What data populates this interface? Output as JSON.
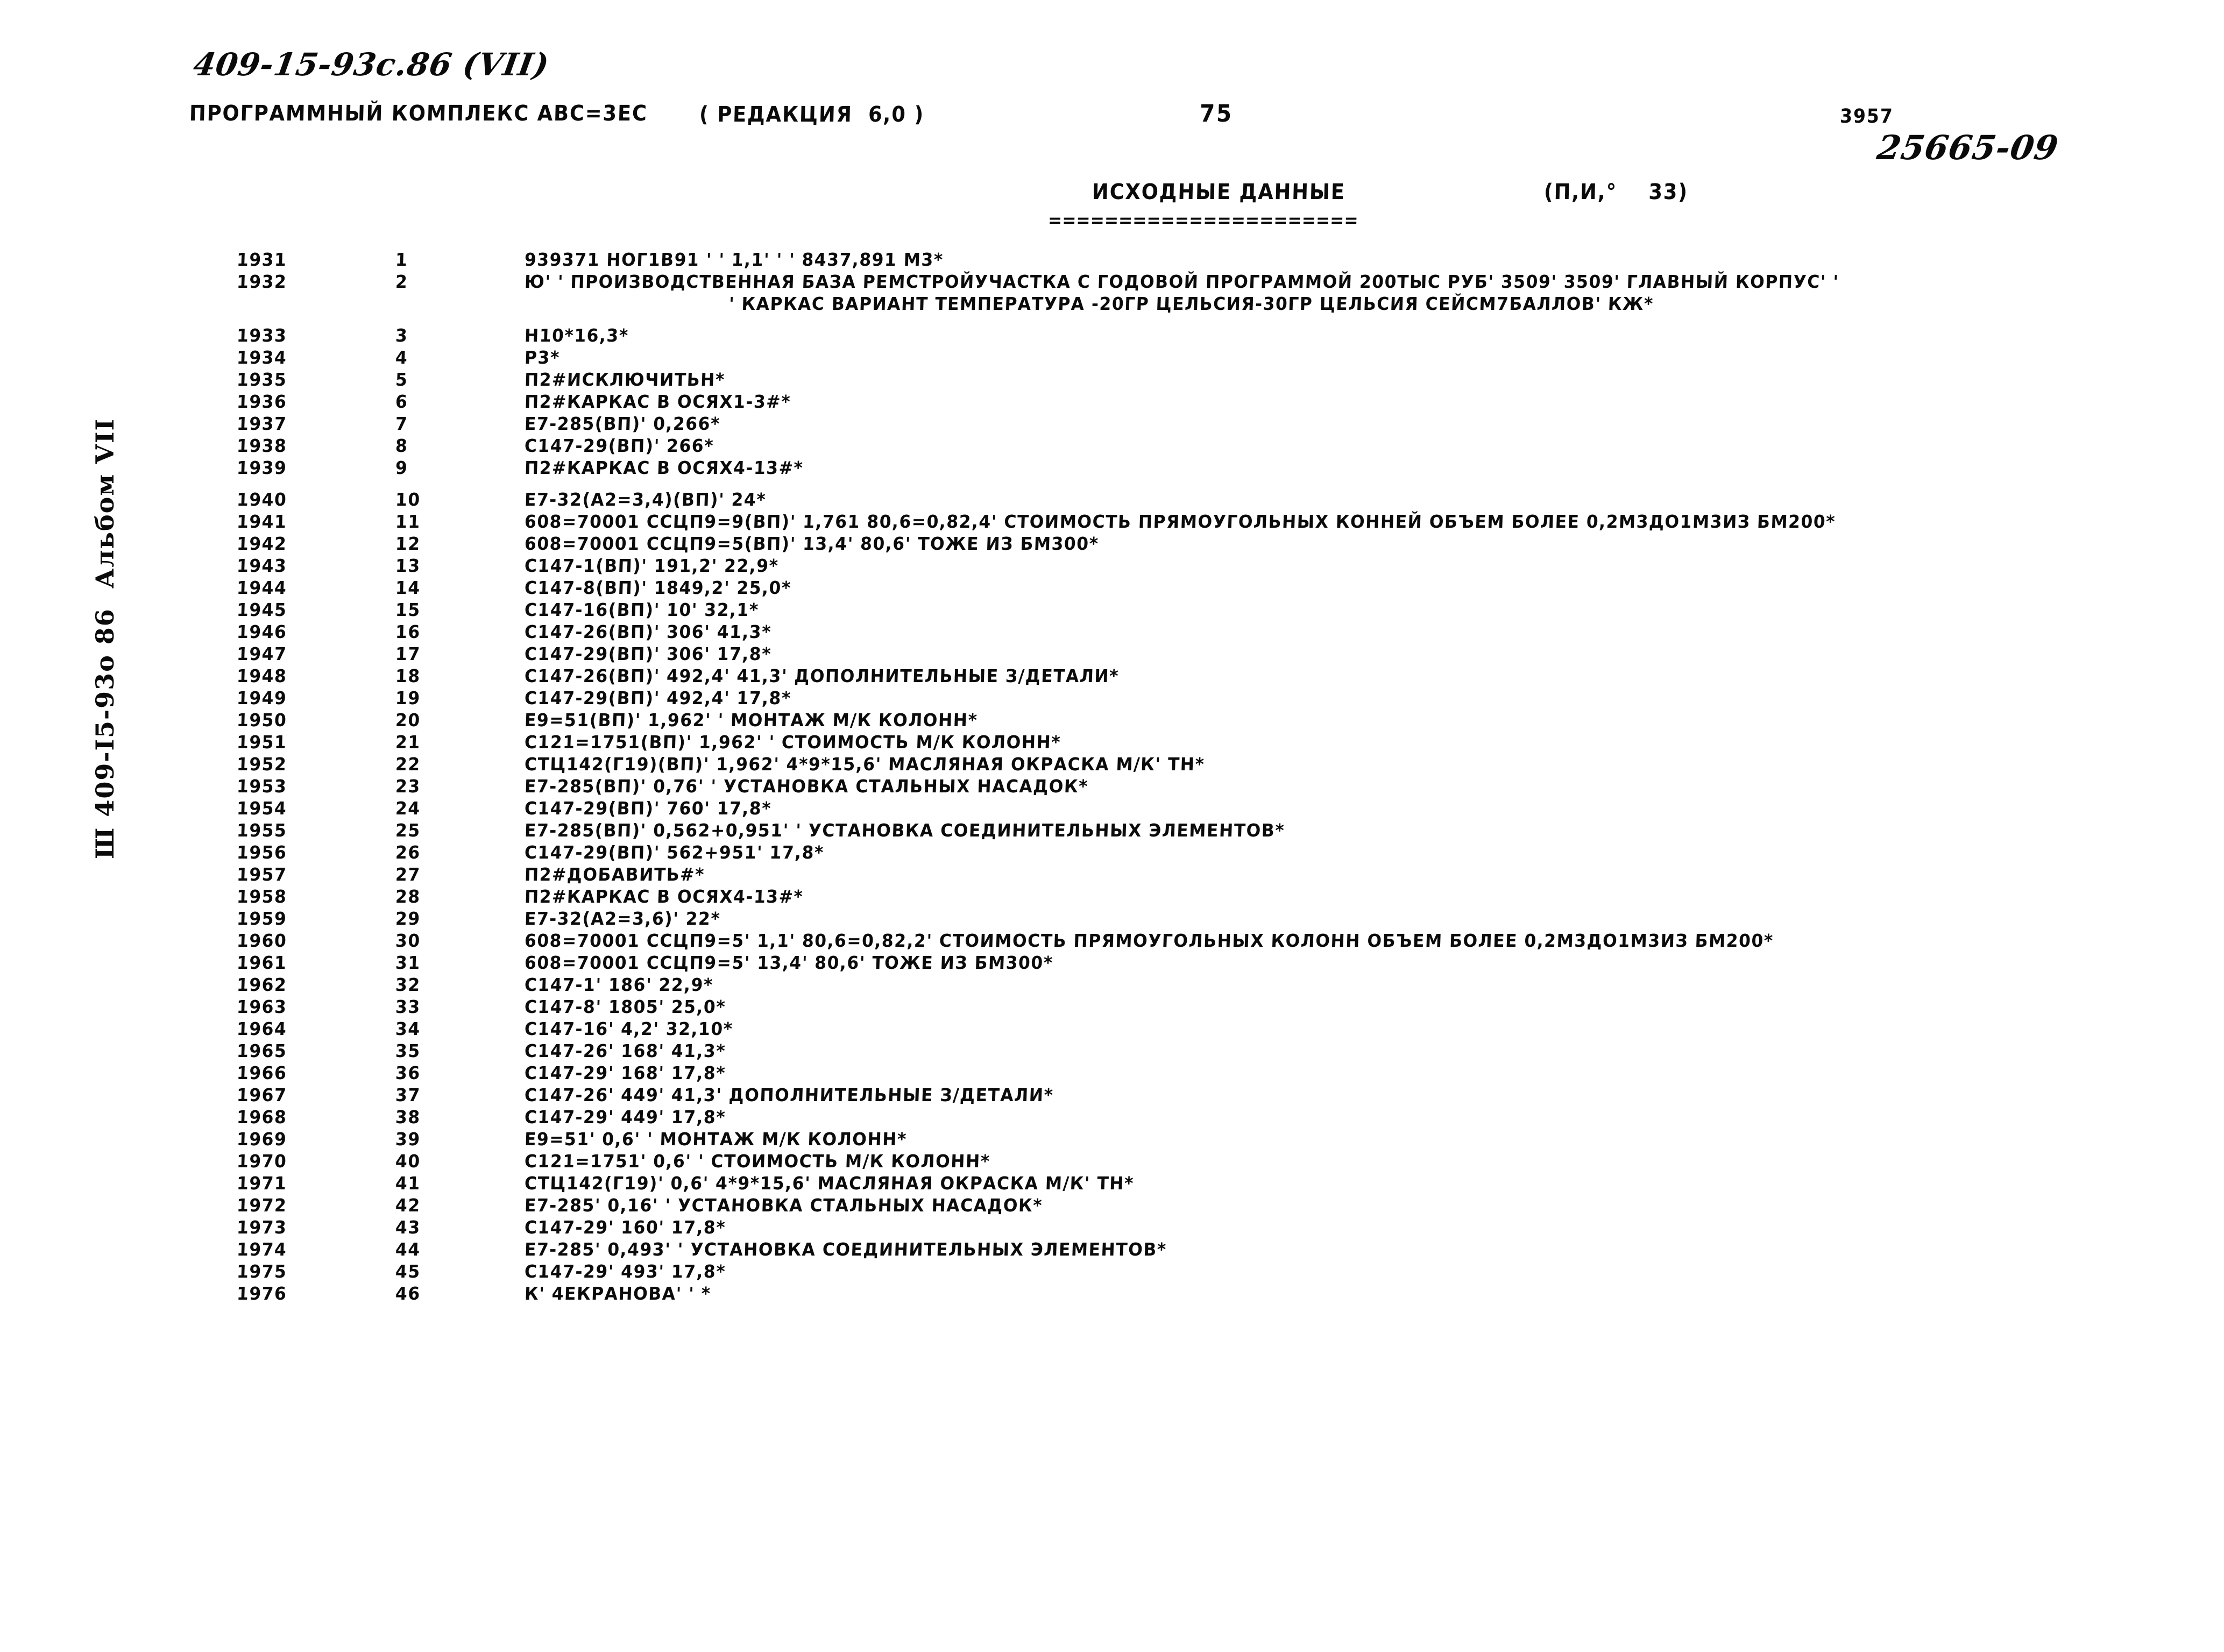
{
  "header": {
    "doc_code_handwritten": "409-15-93с.86 (VII)",
    "complex_line": "ПРОГРАММНЫЙ КОМПЛЕКС АВС=3ЕС",
    "redaction": "( РЕДАКЦИЯ  6,0 )",
    "page_number": "75",
    "small_number": "3957",
    "doc_number_handwritten": "25665-09"
  },
  "section": {
    "title": "ИСХОДНЫЕ ДАННЫЕ",
    "rule": "======================",
    "right_label": "(П,И,°    33)"
  },
  "margin": {
    "vertical_text": "Ш 409-I5-93о 86  Альбом VII"
  },
  "listing": {
    "columns": [
      "id",
      "no",
      "text"
    ],
    "rows": [
      {
        "id": "1931",
        "no": "1",
        "text": "939371 НОГ1В91 ' ' 1,1' ' ' 8437,891 М3*"
      },
      {
        "id": "1932",
        "no": "2",
        "text": "Ю' ' ПРОИЗВОДСТВЕННАЯ БАЗА РЕМСТРОЙУЧАСТКА С ГОДОВОЙ ПРОГРАММОЙ 200ТЫС РУБ' 3509' 3509' ГЛАВНЫЙ КОРПУС' '",
        "cont": "' КАРКАС ВАРИАНТ ТЕМПЕРАТУРА -20ГР ЦЕЛЬСИЯ-30ГР ЦЕЛЬСИЯ СЕЙСМ7БАЛЛОВ' КЖ*"
      },
      {
        "id": "1933",
        "no": "3",
        "text": "Н10*16,3*"
      },
      {
        "id": "1934",
        "no": "4",
        "text": "Р3*"
      },
      {
        "id": "1935",
        "no": "5",
        "text": "П2#ИСКЛЮЧИТЬН*"
      },
      {
        "id": "1936",
        "no": "6",
        "text": "П2#КАРКАС В ОСЯХ1-3#*"
      },
      {
        "id": "1937",
        "no": "7",
        "text": "Е7-285(ВП)' 0,266*"
      },
      {
        "id": "1938",
        "no": "8",
        "text": "С147-29(ВП)' 266*"
      },
      {
        "id": "1939",
        "no": "9",
        "text": "П2#КАРКАС В ОСЯХ4-13#*"
      },
      {
        "id": "1940",
        "no": "10",
        "text": "Е7-32(А2=3,4)(ВП)' 24*"
      },
      {
        "id": "1941",
        "no": "11",
        "text": "608=70001 ССЦП9=9(ВП)' 1,761 80,6=0,82,4' СТОИМОСТЬ ПРЯМОУГОЛЬНЫХ КОННЕЙ ОБЪЕМ БОЛЕЕ 0,2М3ДО1М3ИЗ БМ200*"
      },
      {
        "id": "1942",
        "no": "12",
        "text": "608=70001 ССЦП9=5(ВП)' 13,4' 80,6' ТОЖЕ ИЗ БМ300*"
      },
      {
        "id": "1943",
        "no": "13",
        "text": "С147-1(ВП)' 191,2' 22,9*"
      },
      {
        "id": "1944",
        "no": "14",
        "text": "С147-8(ВП)' 1849,2' 25,0*"
      },
      {
        "id": "1945",
        "no": "15",
        "text": "С147-16(ВП)' 10' 32,1*"
      },
      {
        "id": "1946",
        "no": "16",
        "text": "С147-26(ВП)' 306' 41,3*"
      },
      {
        "id": "1947",
        "no": "17",
        "text": "С147-29(ВП)' 306' 17,8*"
      },
      {
        "id": "1948",
        "no": "18",
        "text": "С147-26(ВП)' 492,4' 41,3' ДОПОЛНИТЕЛЬНЫЕ З/ДЕТАЛИ*"
      },
      {
        "id": "1949",
        "no": "19",
        "text": "С147-29(ВП)' 492,4' 17,8*"
      },
      {
        "id": "1950",
        "no": "20",
        "text": "Е9=51(ВП)' 1,962' ' МОНТАЖ М/К КОЛОНН*"
      },
      {
        "id": "1951",
        "no": "21",
        "text": "С121=1751(ВП)' 1,962' ' СТОИМОСТЬ М/К КОЛОНН*"
      },
      {
        "id": "1952",
        "no": "22",
        "text": "СТЦ142(Г19)(ВП)' 1,962' 4*9*15,6' МАСЛЯНАЯ ОКРАСКА М/К' ТН*"
      },
      {
        "id": "1953",
        "no": "23",
        "text": "Е7-285(ВП)' 0,76' ' УСТАНОВКА СТАЛЬНЫХ НАСАДОК*"
      },
      {
        "id": "1954",
        "no": "24",
        "text": "С147-29(ВП)' 760' 17,8*"
      },
      {
        "id": "1955",
        "no": "25",
        "text": "Е7-285(ВП)' 0,562+0,951' ' УСТАНОВКА СОЕДИНИТЕЛЬНЫХ ЭЛЕМЕНТОВ*"
      },
      {
        "id": "1956",
        "no": "26",
        "text": "С147-29(ВП)' 562+951' 17,8*"
      },
      {
        "id": "1957",
        "no": "27",
        "text": "П2#ДОБАВИТЬ#*"
      },
      {
        "id": "1958",
        "no": "28",
        "text": "П2#КАРКАС В ОСЯХ4-13#*"
      },
      {
        "id": "1959",
        "no": "29",
        "text": "Е7-32(А2=3,6)' 22*"
      },
      {
        "id": "1960",
        "no": "30",
        "text": "608=70001 ССЦП9=5' 1,1' 80,6=0,82,2' СТОИМОСТЬ ПРЯМОУГОЛЬНЫХ КОЛОНН ОБЪЕМ БОЛЕЕ 0,2М3ДО1М3ИЗ БМ200*"
      },
      {
        "id": "1961",
        "no": "31",
        "text": "608=70001 ССЦП9=5' 13,4' 80,6' ТОЖЕ ИЗ БМ300*"
      },
      {
        "id": "1962",
        "no": "32",
        "text": "С147-1' 186' 22,9*"
      },
      {
        "id": "1963",
        "no": "33",
        "text": "С147-8' 1805' 25,0*"
      },
      {
        "id": "1964",
        "no": "34",
        "text": "С147-16' 4,2' 32,10*"
      },
      {
        "id": "1965",
        "no": "35",
        "text": "С147-26' 168' 41,3*"
      },
      {
        "id": "1966",
        "no": "36",
        "text": "С147-29' 168' 17,8*"
      },
      {
        "id": "1967",
        "no": "37",
        "text": "С147-26' 449' 41,3' ДОПОЛНИТЕЛЬНЫЕ З/ДЕТАЛИ*"
      },
      {
        "id": "1968",
        "no": "38",
        "text": "С147-29' 449' 17,8*"
      },
      {
        "id": "1969",
        "no": "39",
        "text": "Е9=51' 0,6' ' МОНТАЖ М/К КОЛОНН*"
      },
      {
        "id": "1970",
        "no": "40",
        "text": "С121=1751' 0,6' ' СТОИМОСТЬ М/К КОЛОНН*"
      },
      {
        "id": "1971",
        "no": "41",
        "text": "СТЦ142(Г19)' 0,6' 4*9*15,6' МАСЛЯНАЯ ОКРАСКА М/К' ТН*"
      },
      {
        "id": "1972",
        "no": "42",
        "text": "Е7-285' 0,16' ' УСТАНОВКА СТАЛЬНЫХ НАСАДОК*"
      },
      {
        "id": "1973",
        "no": "43",
        "text": "С147-29' 160' 17,8*"
      },
      {
        "id": "1974",
        "no": "44",
        "text": "Е7-285' 0,493' ' УСТАНОВКА СОЕДИНИТЕЛЬНЫХ ЭЛЕМЕНТОВ*"
      },
      {
        "id": "1975",
        "no": "45",
        "text": "С147-29' 493' 17,8*"
      },
      {
        "id": "1976",
        "no": "46",
        "text": "К' 4ЕКРАНОВА' ' *"
      }
    ]
  }
}
